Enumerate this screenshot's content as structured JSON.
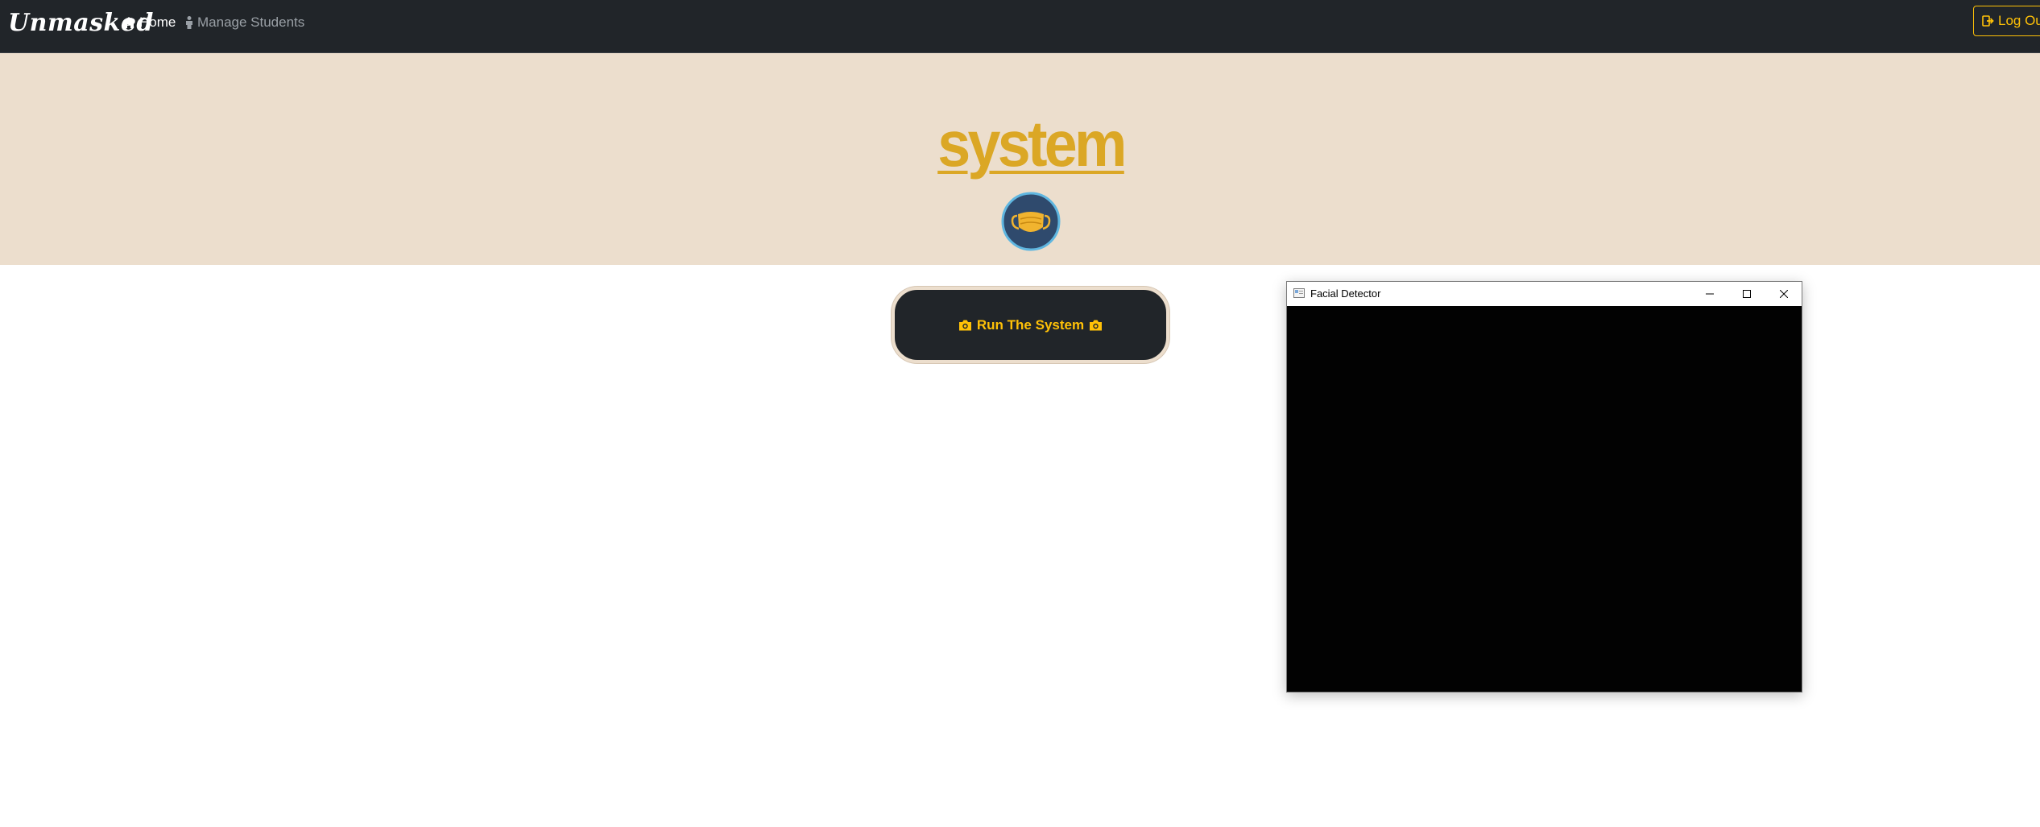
{
  "navbar": {
    "brand": "Unmasked",
    "home_label": "Home",
    "manage_students_label": "Manage Students",
    "logout_label": "Log Out"
  },
  "hero": {
    "title": "system",
    "logo_icon": "face-mask-icon"
  },
  "main": {
    "run_button_label": "Run The System"
  },
  "popup_window": {
    "title": "Facial Detector",
    "content": "camera-feed"
  },
  "colors": {
    "navbar_bg": "#212529",
    "hero_bg": "#ecdecd",
    "accent": "#ffc107",
    "title_gold": "#dba725",
    "logo_circle": "#2f4a6d"
  }
}
